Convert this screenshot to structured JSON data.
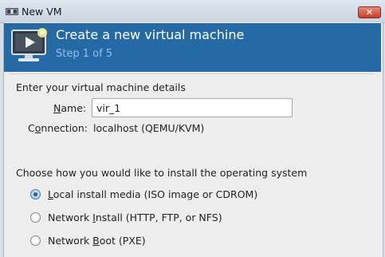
{
  "window": {
    "title": "New VM",
    "close_label": "✕"
  },
  "header": {
    "title": "Create a new virtual machine",
    "step": "Step 1 of 5",
    "colors": {
      "banner": "#2569a5",
      "step_text": "#8ec1ee"
    }
  },
  "details": {
    "section_title": "Enter your virtual machine details",
    "name_label_prefix": "",
    "name_label_mnemonic": "N",
    "name_label_rest": "ame:",
    "name_value": "vir_1",
    "connection_label_prefix": "C",
    "connection_label_mnemonic": "o",
    "connection_label_rest": "nnection:",
    "connection_value": "localhost (QEMU/KVM)"
  },
  "install": {
    "section_title": "Choose how you would like to install the operating system",
    "options": [
      {
        "prefix": "",
        "mnemonic": "L",
        "rest": "ocal install media (ISO image or CDROM)",
        "selected": true
      },
      {
        "prefix": "Network ",
        "mnemonic": "I",
        "rest": "nstall (HTTP, FTP, or NFS)",
        "selected": false
      },
      {
        "prefix": "Network ",
        "mnemonic": "B",
        "rest": "oot (PXE)",
        "selected": false
      }
    ]
  }
}
